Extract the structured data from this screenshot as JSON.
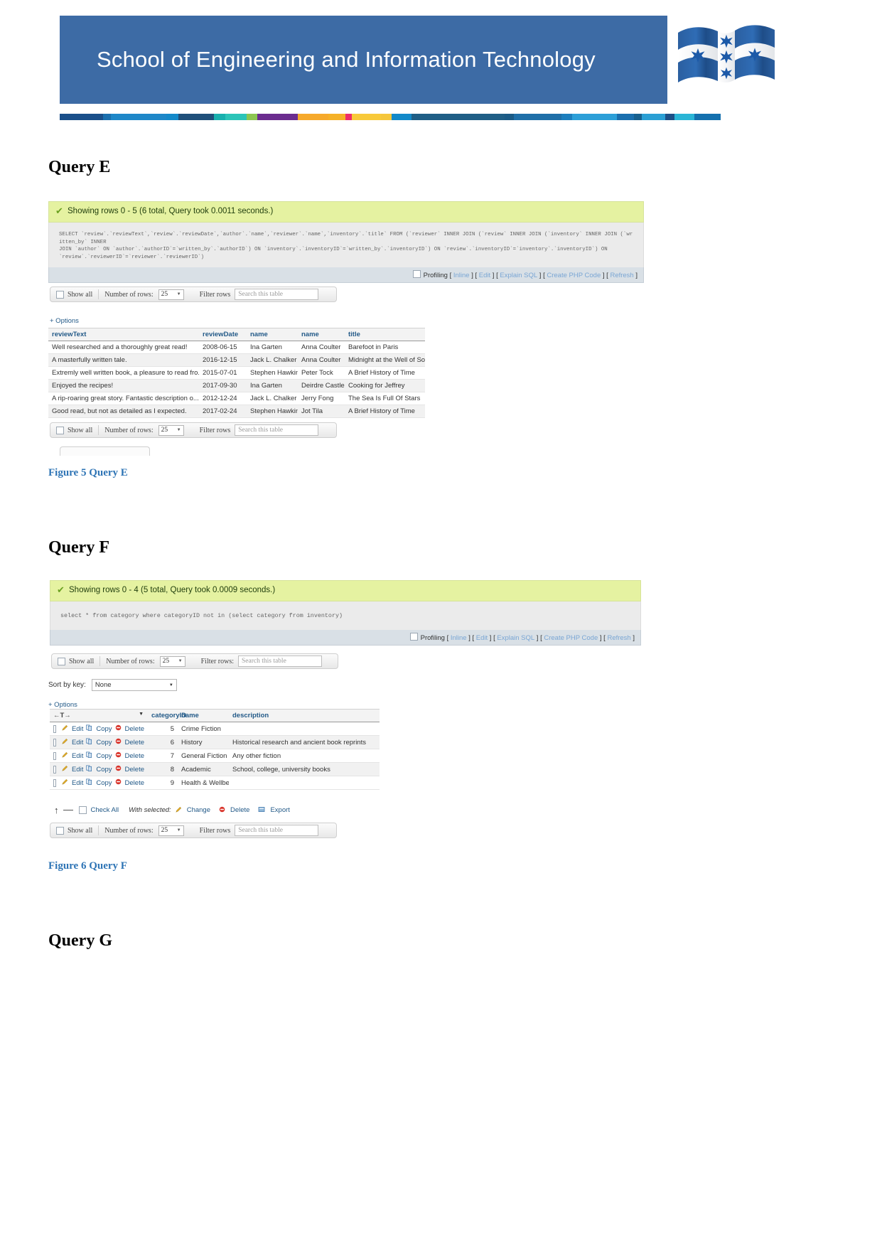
{
  "header": {
    "title": "School of Engineering and Information Technology",
    "logo_name": "victoria-university-flag-logo",
    "bg_color": "#3d6ba5",
    "stripe_colors": [
      "#1a4f8a",
      "#1a6fae",
      "#1e87c8",
      "#1489c9",
      "#1f4f7a",
      "#18b0ae",
      "#2bc4b8",
      "#8cc551",
      "#6b2d8f",
      "#f6a92b",
      "#f5b128",
      "#ee2d6a",
      "#f8c93a",
      "#f5c63c",
      "#1289c9",
      "#1f5e86",
      "#1a5a86",
      "#1f6fa8",
      "#1c7ebd",
      "#2c9fd8",
      "#1a6fae",
      "#17608e",
      "#2a9fd4",
      "#1c4f86",
      "#2ab5d6",
      "#1470ae"
    ]
  },
  "sections": {
    "query_e": {
      "heading": "Query E",
      "caption": "Figure 5 Query E",
      "status": "Showing rows 0 - 5 (6 total, Query took 0.0011 seconds.)",
      "sql_lines": [
        "SELECT `review`.`reviewText`,`review`.`reviewDate`,`author`.`name`,`reviewer`.`name`,`inventory`.`title` FROM (`reviewer` INNER JOIN (`review` INNER JOIN (`inventory` INNER JOIN (`written_by` INNER",
        "JOIN `author` ON `author`.`authorID`=`written_by`.`authorID`) ON `inventory`.`inventoryID`=`written_by`.`inventoryID`) ON `review`.`inventoryID`=`inventory`.`inventoryID`) ON",
        "`review`.`reviewerID`=`reviewer`.`reviewerID`)"
      ],
      "action_bar": {
        "profiling_label": "Profiling",
        "links": [
          "Inline",
          "Edit",
          "Explain SQL",
          "Create PHP Code",
          "Refresh"
        ]
      },
      "toolbar": {
        "show_all": "Show all",
        "number_of_rows_label": "Number of rows:",
        "rows_value": "25",
        "filter_label": "Filter rows",
        "filter_placeholder": "Search this table"
      },
      "options_link": "+ Options",
      "table": {
        "columns": [
          "reviewText",
          "reviewDate",
          "name",
          "name",
          "title"
        ],
        "rows": [
          [
            "Well researched and a thoroughly great read!",
            "2008-06-15",
            "Ina Garten",
            "Anna Coulter",
            "Barefoot in Paris"
          ],
          [
            "A masterfully written tale.",
            "2016-12-15",
            "Jack L. Chalker",
            "Anna Coulter",
            "Midnight at the Well of Souls"
          ],
          [
            "Extremly well written book, a pleasure to read fro...",
            "2015-07-01",
            "Stephen Hawking",
            "Peter Tock",
            "A Brief History of Time"
          ],
          [
            "Enjoyed the recipes!",
            "2017-09-30",
            "Ina Garten",
            "Deirdre Castle",
            "Cooking for Jeffrey"
          ],
          [
            "A rip-roaring great story. Fantastic description o...",
            "2012-12-24",
            "Jack L. Chalker",
            "Jerry Fong",
            "The Sea Is Full Of Stars"
          ],
          [
            "Good read, but not as detailed as I expected.",
            "2017-02-24",
            "Stephen Hawking",
            "Jot Tila",
            "A Brief History of Time"
          ]
        ]
      }
    },
    "query_f": {
      "heading": "Query F",
      "caption": "Figure 6 Query F",
      "status": "Showing rows 0 - 4 (5 total, Query took 0.0009 seconds.)",
      "sql_lines": [
        "select * from category where categoryID not in (select category from inventory)"
      ],
      "action_bar": {
        "profiling_label": "Profiling",
        "links": [
          "Inline",
          "Edit",
          "Explain SQL",
          "Create PHP Code",
          "Refresh"
        ]
      },
      "toolbar": {
        "show_all": "Show all",
        "number_of_rows_label": "Number of rows:",
        "rows_value": "25",
        "filter_label": "Filter rows:",
        "filter_placeholder": "Search this table"
      },
      "sort_by_key_label": "Sort by key:",
      "sort_by_key_value": "None",
      "options_link": "+ Options",
      "table": {
        "op_column_header": "←T→",
        "columns": [
          "categoryID",
          "name",
          "description"
        ],
        "row_actions": [
          "Edit",
          "Copy",
          "Delete"
        ],
        "rows": [
          [
            "5",
            "Crime Fiction",
            ""
          ],
          [
            "6",
            "History",
            "Historical research and ancient book reprints"
          ],
          [
            "7",
            "General Fiction",
            "Any other fiction"
          ],
          [
            "8",
            "Academic",
            "School, college, university books"
          ],
          [
            "9",
            "Health & Wellbeing",
            ""
          ]
        ]
      },
      "footer_actions": {
        "check_all": "Check All",
        "with_selected": "With selected:",
        "change": "Change",
        "delete": "Delete",
        "export": "Export"
      },
      "bottom_toolbar": {
        "show_all": "Show all",
        "number_of_rows_label": "Number of rows:",
        "rows_value": "25",
        "filter_label": "Filter rows",
        "filter_placeholder": "Search this table"
      }
    },
    "query_g": {
      "heading": "Query G"
    }
  }
}
